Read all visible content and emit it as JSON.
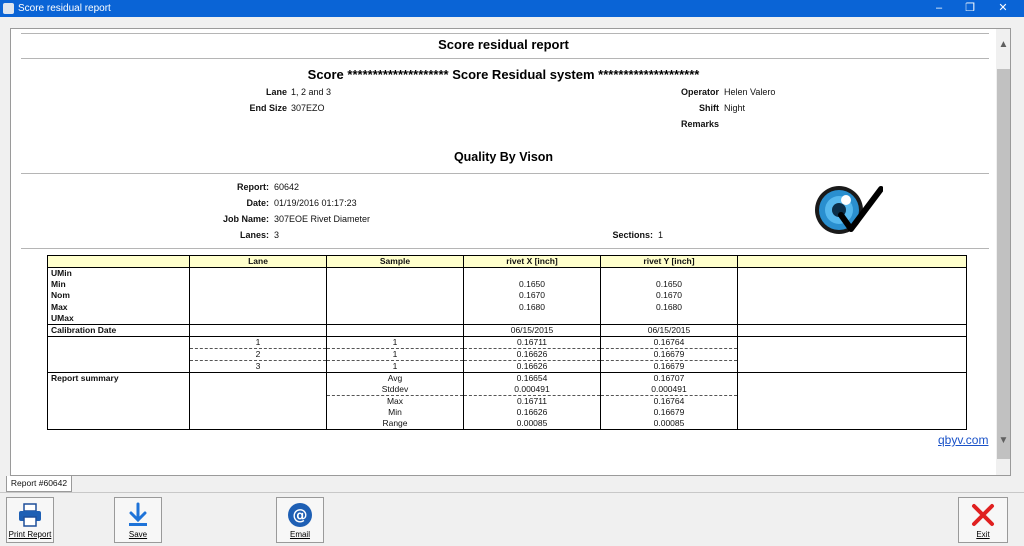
{
  "window": {
    "title": "Score residual report"
  },
  "report": {
    "main_title": "Score residual report",
    "system_title": "Score ******************** Score Residual system ********************",
    "lane_label": "Lane",
    "lane_value": "1, 2 and 3",
    "endsize_label": "End Size",
    "endsize_value": "307EZO",
    "operator_label": "Operator",
    "operator_value": "Helen Valero",
    "shift_label": "Shift",
    "shift_value": "Night",
    "remarks_label": "Remarks",
    "qbv_title": "Quality By Vison",
    "report_label": "Report:",
    "report_value": "60642",
    "date_label": "Date:",
    "date_value": "01/19/2016 01:17:23",
    "jobname_label": "Job Name:",
    "jobname_value": "307EOE Rivet Diameter",
    "lanes_label": "Lanes:",
    "lanes_value": "3",
    "sections_label": "Sections:",
    "sections_value": "1"
  },
  "table": {
    "headers": [
      "",
      "Lane",
      "Sample",
      "rivet X [inch]",
      "rivet Y [inch]",
      ""
    ],
    "spec_labels": [
      "UMin",
      "Min",
      "Nom",
      "Max",
      "UMax"
    ],
    "spec_x": [
      "",
      "0.1650",
      "0.1670",
      "0.1680",
      ""
    ],
    "spec_y": [
      "",
      "0.1650",
      "0.1670",
      "0.1680",
      ""
    ],
    "calibration": {
      "label": "Calibration Date",
      "x": "06/15/2015",
      "y": "06/15/2015"
    },
    "samples": [
      {
        "lane": "1",
        "sample": "1",
        "x": "0.16711",
        "y": "0.16764"
      },
      {
        "lane": "2",
        "sample": "1",
        "x": "0.16626",
        "y": "0.16679"
      },
      {
        "lane": "3",
        "sample": "1",
        "x": "0.16626",
        "y": "0.16679"
      }
    ],
    "summary_label": "Report summary",
    "summary": [
      {
        "stat": "Avg",
        "x": "0.16654",
        "y": "0.16707"
      },
      {
        "stat": "Stddev",
        "x": "0.000491",
        "y": "0.000491"
      },
      {
        "stat": "Max",
        "x": "0.16711",
        "y": "0.16764"
      },
      {
        "stat": "Min",
        "x": "0.16626",
        "y": "0.16679"
      },
      {
        "stat": "Range",
        "x": "0.00085",
        "y": "0.00085"
      }
    ]
  },
  "link": "qbyv.com",
  "tab_label": "Report #60642",
  "toolbar": {
    "print": "Print Report",
    "save": "Save",
    "email": "Email",
    "exit": "Exit"
  },
  "colors": {
    "titlebar": "#0a64d6",
    "header_fill": "#ffffcc",
    "link": "#1a52c8",
    "exit_red": "#e02020"
  }
}
